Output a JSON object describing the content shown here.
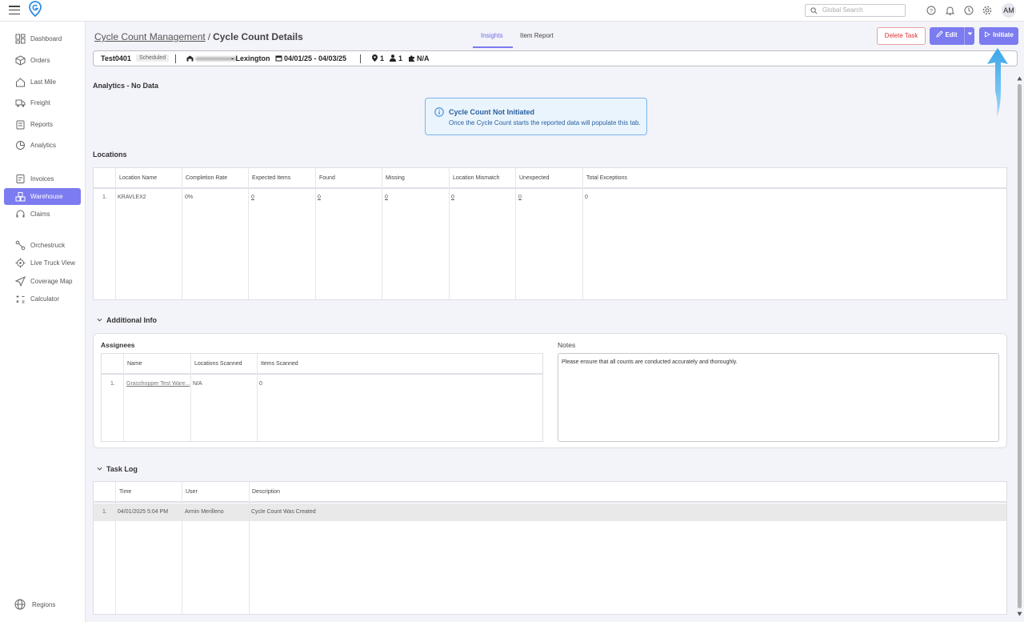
{
  "topbar": {
    "search_placeholder": "Global Search",
    "avatar_initials": "AM"
  },
  "sidebar": {
    "items": [
      {
        "label": "Dashboard",
        "icon": "dashboard-icon"
      },
      {
        "label": "Orders",
        "icon": "box-icon"
      },
      {
        "label": "Last Mile",
        "icon": "house-icon"
      },
      {
        "label": "Freight",
        "icon": "truck-icon"
      },
      {
        "label": "Reports",
        "icon": "report-icon"
      },
      {
        "label": "Analytics",
        "icon": "analytics-icon"
      },
      {
        "label": "Invoices",
        "icon": "invoice-icon"
      },
      {
        "label": "Warehouse",
        "icon": "warehouse-icon",
        "active": true
      },
      {
        "label": "Claims",
        "icon": "headset-icon"
      },
      {
        "label": "Orchestruck",
        "icon": "route-icon"
      },
      {
        "label": "Live Truck View",
        "icon": "locate-icon"
      },
      {
        "label": "Coverage Map",
        "icon": "send-icon"
      },
      {
        "label": "Calculator",
        "icon": "calculator-icon"
      },
      {
        "label": "Regions",
        "icon": "globe-icon"
      }
    ]
  },
  "header": {
    "breadcrumb_parent": "Cycle Count Management",
    "breadcrumb_sep": "/",
    "breadcrumb_current": "Cycle Count Details",
    "tabs": [
      {
        "label": "Insights",
        "active": true
      },
      {
        "label": "Item Report"
      }
    ],
    "delete_label": "Delete Task",
    "edit_label": "Edit",
    "initiate_label": "Initiate"
  },
  "info": {
    "task_name": "Test0401",
    "status": "Scheduled",
    "location": "- Lexington",
    "dates": "04/01/25 - 04/03/25",
    "locations_count": "1",
    "users_count": "1",
    "extra": "N/A"
  },
  "analytics": {
    "title": "Analytics - No Data",
    "notice_title": "Cycle Count Not Initiated",
    "notice_message": "Once the Cycle Count starts the reported data will populate this tab."
  },
  "locations": {
    "title": "Locations",
    "columns": [
      "Location Name",
      "Completion Rate",
      "Expected Items",
      "Found",
      "Missing",
      "Location Mismatch",
      "Unexpected",
      "Total Exceptions"
    ],
    "rows": [
      {
        "num": "1.",
        "name": "KRAVLEX2",
        "completion": "0%",
        "expected": "0",
        "found": "0",
        "missing": "0",
        "mismatch": "0",
        "unexpected": "0",
        "total": "0"
      }
    ]
  },
  "additional": {
    "title": "Additional Info",
    "assignees_title": "Assignees",
    "assignee_columns": [
      "Name",
      "Locations Scanned",
      "Items Scanned"
    ],
    "assignees": [
      {
        "num": "1.",
        "name": "Grasshopper Test Ware...",
        "locations": "N/A",
        "items": "0"
      }
    ],
    "notes_title": "Notes",
    "notes": "Please ensure that all counts are conducted accurately and thoroughly."
  },
  "tasklog": {
    "title": "Task Log",
    "columns": [
      "Time",
      "User",
      "Description"
    ],
    "rows": [
      {
        "num": "1.",
        "time": "04/01/2025 5:04 PM",
        "user": "Armin Merilleno",
        "desc": "Cycle Count Was Created"
      }
    ]
  },
  "colors": {
    "accent": "#7c7bf0",
    "delete": "#dd3333",
    "notice": "#2a5f9e"
  }
}
